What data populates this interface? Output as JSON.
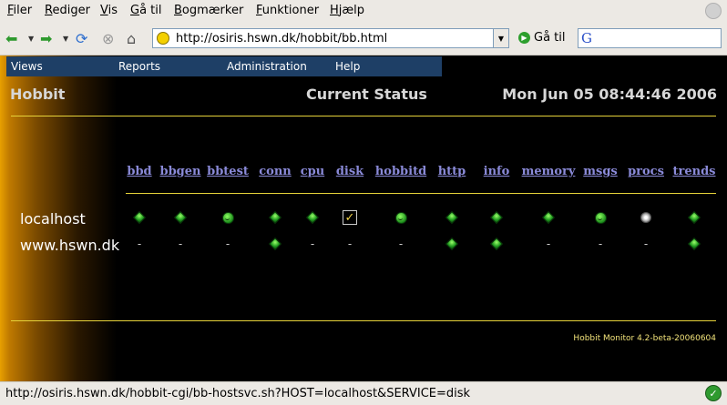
{
  "browser": {
    "menu": [
      "Filer",
      "Rediger",
      "Vis",
      "Gå til",
      "Bogmærker",
      "Funktioner",
      "Hjælp"
    ],
    "url": "http://osiris.hswn.dk/hobbit/bb.html",
    "go_label": "Gå til",
    "search_value": "",
    "status_text": "http://osiris.hswn.dk/hobbit-cgi/bb-hostsvc.sh?HOST=localhost&SERVICE=disk"
  },
  "nav": [
    "Views",
    "Reports",
    "Administration",
    "Help"
  ],
  "header": {
    "brand": "Hobbit",
    "title": "Current Status",
    "datetime": "Mon Jun 05 08:44:46 2006"
  },
  "columns": [
    "bbd",
    "bbgen",
    "bbtest",
    "conn",
    "cpu",
    "disk",
    "hobbitd",
    "http",
    "info",
    "memory",
    "msgs",
    "procs",
    "trends"
  ],
  "hosts": [
    {
      "name": "localhost",
      "status": [
        "green",
        "green",
        "green-face",
        "green",
        "green",
        "checked",
        "green-face",
        "green",
        "green",
        "green",
        "green-face",
        "clear",
        "green"
      ]
    },
    {
      "name": "www.hswn.dk",
      "status": [
        "-",
        "-",
        "-",
        "green",
        "-",
        "-",
        "-",
        "green",
        "green",
        "-",
        "-",
        "-",
        "green"
      ]
    }
  ],
  "footer": "Hobbit Monitor 4.2-beta-20060604",
  "colors": {
    "accent_line": "#e6d23a",
    "nav_bg": "#1e3f66",
    "link": "#8a8ad8"
  }
}
